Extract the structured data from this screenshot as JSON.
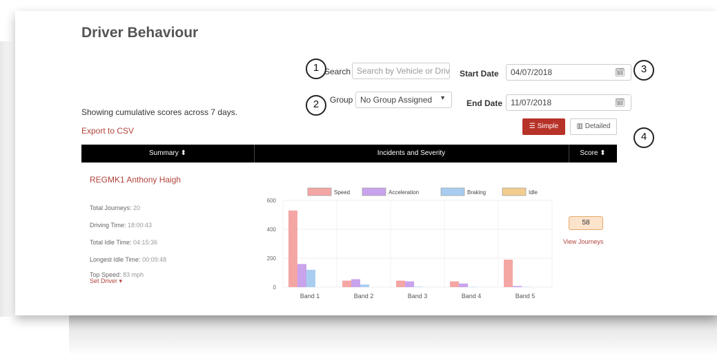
{
  "page": {
    "title": "Driver Behaviour",
    "info": "Showing cumulative scores across 7 days.",
    "export": "Export to CSV"
  },
  "filters": {
    "search_label": "Search",
    "search_placeholder": "Search by Vehicle or Driv",
    "group_label": "Group",
    "group_value": "No Group Assigned",
    "start_label": "Start Date",
    "start_value": "04/07/2018",
    "end_label": "End Date",
    "end_value": "11/07/2018"
  },
  "view_buttons": {
    "simple": "Simple",
    "detailed": "Detailed"
  },
  "callouts": [
    "1",
    "2",
    "3",
    "4"
  ],
  "table": {
    "headers": [
      "Summary ⬍",
      "Incidents and Severity",
      "Score ⬍"
    ]
  },
  "driver": {
    "name": "REGMK1 Anthony Haigh",
    "stats": [
      {
        "label": "Total Journeys:",
        "value": "20"
      },
      {
        "label": "Driving Time:",
        "value": "18:00:43"
      },
      {
        "label": "Total Idle Time:",
        "value": "04:15:36"
      },
      {
        "label": "Longest Idle Time:",
        "value": "00:09:48"
      },
      {
        "label": "Top Speed:",
        "value": "83 mph"
      }
    ],
    "set_driver": "Set Driver ▾",
    "score": "58",
    "view_journeys": "View Journeys"
  },
  "chart_data": {
    "type": "bar",
    "categories": [
      "Band 1",
      "Band 2",
      "Band 3",
      "Band 4",
      "Band 5"
    ],
    "series": [
      {
        "name": "Speed",
        "values": [
          530,
          45,
          45,
          40,
          190
        ],
        "color": "#f4a6a4"
      },
      {
        "name": "Acceleration",
        "values": [
          160,
          55,
          40,
          25,
          8
        ],
        "color": "#c9a3ec"
      },
      {
        "name": "Braking",
        "values": [
          120,
          18,
          3,
          2,
          2
        ],
        "color": "#a8cdf0"
      },
      {
        "name": "Idle",
        "values": [
          0,
          0,
          0,
          0,
          0
        ],
        "color": "#f2cc8f"
      }
    ],
    "ylim": [
      0,
      600
    ],
    "yticks": [
      0,
      200,
      400,
      600
    ],
    "legend": "top",
    "grid": true
  }
}
